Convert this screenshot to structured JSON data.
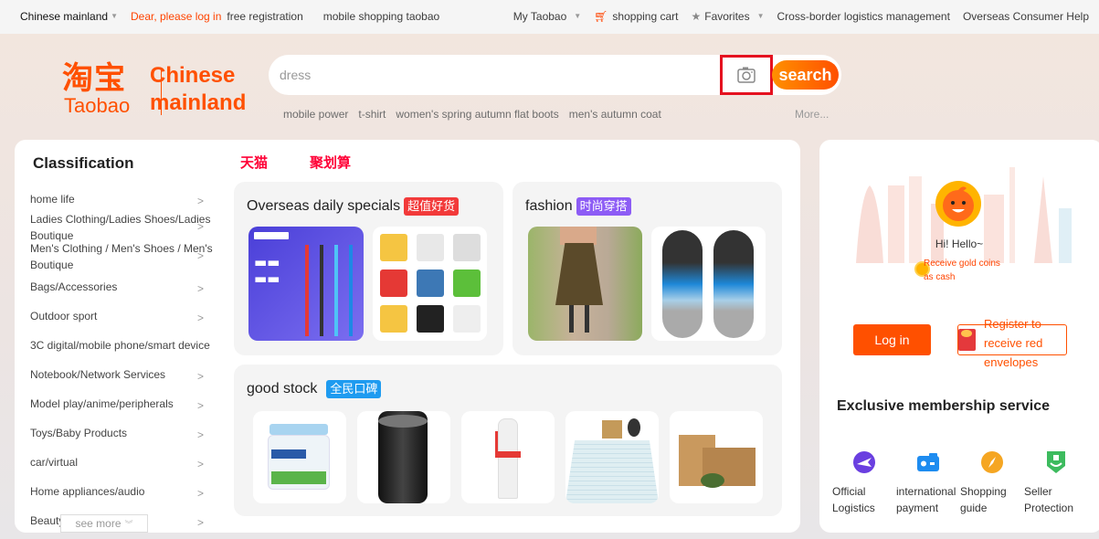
{
  "topbar": {
    "region": "Chinese mainland",
    "login_prompt": "Dear, please log in",
    "free_registration": "free registration",
    "mobile_shopping": "mobile shopping taobao",
    "my_taobao": "My Taobao",
    "shopping_cart": "shopping cart",
    "favorites": "Favorites",
    "cross_border": "Cross-border logistics management",
    "consumer_help": "Overseas Consumer Help"
  },
  "logo": {
    "chinese": "淘宝",
    "english": "Taobao",
    "region_line1": "Chinese",
    "region_line2": "mainland"
  },
  "search": {
    "value": "dress",
    "button_label": "search",
    "hot_words": [
      "mobile power",
      "t-shirt",
      "women's spring autumn flat boots",
      "men's autumn coat"
    ],
    "more_label": "More..."
  },
  "classification": {
    "title": "Classification",
    "items": [
      {
        "label": "home life"
      },
      {
        "label": "Ladies Clothing/Ladies Shoes/Ladies Boutique"
      },
      {
        "label": "Men's Clothing / Men's Shoes / Men's Boutique"
      },
      {
        "label": "Bags/Accessories"
      },
      {
        "label": "Outdoor sport"
      },
      {
        "label": "3C digital/mobile phone/smart device"
      },
      {
        "label": "Notebook/Network Services"
      },
      {
        "label": "Model play/anime/peripherals"
      },
      {
        "label": "Toys/Baby Products"
      },
      {
        "label": "car/virtual"
      },
      {
        "label": "Home appliances/audio"
      },
      {
        "label": "Beauty"
      }
    ],
    "see_more": "see more"
  },
  "tabs": [
    "天猫",
    "聚划算"
  ],
  "panels": {
    "overseas": {
      "title": "Overseas daily specials",
      "tag": "超值好货",
      "tag_color": "#f23a3a",
      "products": [
        "pen-product-image",
        "kids-tshirts-product-image"
      ]
    },
    "fashion": {
      "title": "fashion",
      "tag": "时尚穿搭",
      "tag_color": "#8d5cf5",
      "products": [
        "skirt-product-image",
        "flip-flops-product-image"
      ]
    },
    "good_stock": {
      "title": "good stock",
      "tag": "全民口碑",
      "tag_color": "#1e9bf0",
      "products": [
        "milk-powder-product-image",
        "camera-lens-product-image",
        "skincare-bottle-product-image",
        "tablecloth-product-image",
        "tea-box-product-image"
      ]
    }
  },
  "user": {
    "greeting": "Hi! Hello~",
    "coins_line1": "Receive gold coins",
    "coins_line2": "as cash",
    "login_label": "Log in",
    "register_label": "Register to receive red envelopes",
    "member_title": "Exclusive membership service",
    "services": [
      {
        "line1": "Official",
        "line2": "Logistics",
        "icon": "plane-globe-icon",
        "color": "#6a3fe0"
      },
      {
        "line1": "international",
        "line2": "payment",
        "icon": "wallet-icon",
        "color": "#1e8cf0"
      },
      {
        "line1": "Shopping",
        "line2": "guide",
        "icon": "compass-icon",
        "color": "#f5a623"
      },
      {
        "line1": "Seller",
        "line2": "Protection",
        "icon": "shield-hand-icon",
        "color": "#3dbb5e"
      }
    ]
  }
}
